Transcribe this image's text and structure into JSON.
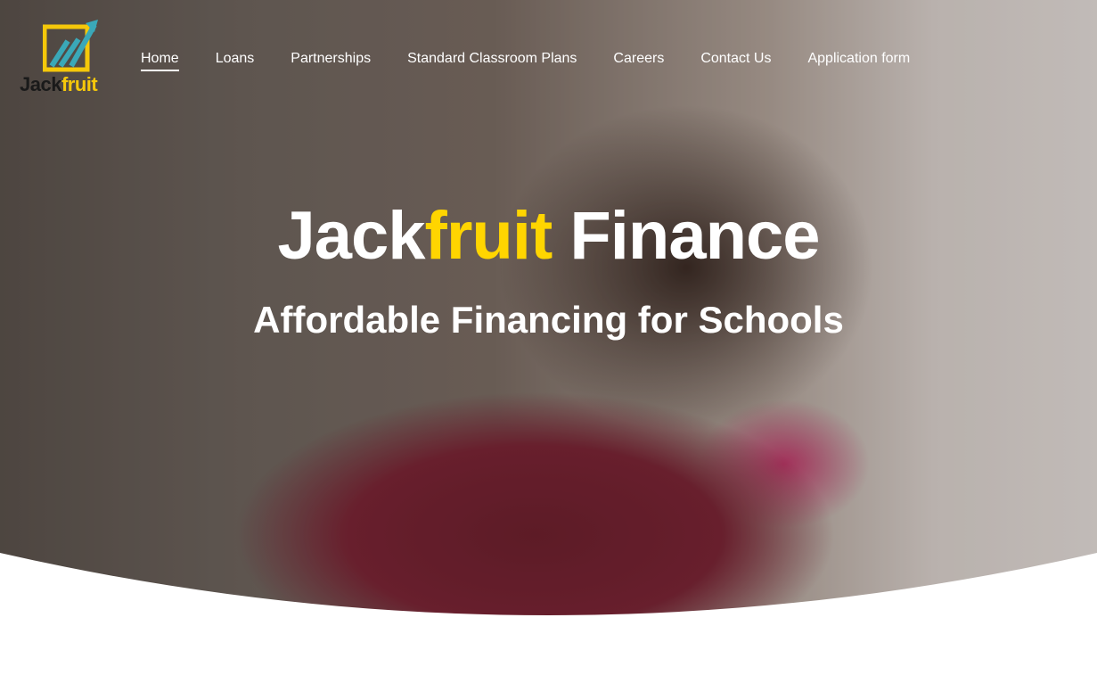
{
  "brand": {
    "name_part1": "Jack",
    "name_part2": "fruit",
    "colors": {
      "accent_yellow": "#ffd500",
      "logo_teal": "#3aa8b8",
      "logo_yellow": "#f5c80a",
      "logo_dark": "#1a1a1a"
    }
  },
  "nav": {
    "items": [
      {
        "label": "Home",
        "active": true
      },
      {
        "label": "Loans",
        "active": false
      },
      {
        "label": "Partnerships",
        "active": false
      },
      {
        "label": "Standard Classroom Plans",
        "active": false
      },
      {
        "label": "Careers",
        "active": false
      },
      {
        "label": "Contact Us",
        "active": false
      },
      {
        "label": "Application form",
        "active": false
      }
    ]
  },
  "hero": {
    "title_part1": "Jack",
    "title_part2": "fruit",
    "title_part3": " Finance",
    "subtitle": "Affordable Financing for Schools",
    "image_subject": "child-writing-on-chalkboard"
  }
}
